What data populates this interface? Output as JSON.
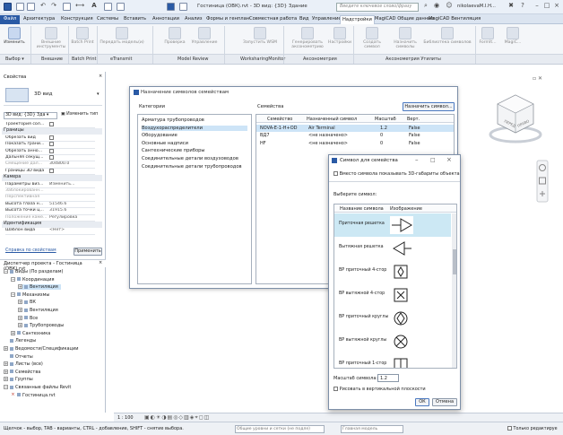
{
  "title_bar": {
    "title": "Гостиница (ОВК).rvt - 3D вид: {3D} Здание",
    "search_placeholder": "Введите ключевое слово/фразу",
    "user": "nikolaevaM.I.H...",
    "icons": [
      "revit-logo-icon",
      "open-icon",
      "save-icon",
      "undo-icon",
      "redo-icon",
      "print-icon",
      "measure-icon",
      "text-icon",
      "3d-view-icon",
      "section-icon",
      "thin-lines-icon",
      "switch-windows-icon",
      "search-icon",
      "signin-icon",
      "exchange-icon",
      "help-icon"
    ]
  },
  "ribbon": {
    "tabs": [
      "Файл",
      "Архитектура",
      "Конструкция",
      "Системы",
      "Вставить",
      "Аннотации",
      "Анализ",
      "Формы и генплан",
      "Совместная работа",
      "Вид",
      "Управление",
      "Надстройки",
      "MagiCAD Общие данные",
      "MagiCAD Вентиляция"
    ],
    "active_tab": "Надстройки",
    "buttons": [
      {
        "label": "Изменить",
        "enabled": true
      },
      {
        "label": "Внешние инструменты",
        "enabled": false
      },
      {
        "label": "Batch Print",
        "enabled": false
      },
      {
        "label": "Передать модель(и)",
        "enabled": false
      },
      {
        "label": "Проверка",
        "enabled": false
      },
      {
        "label": "Управление",
        "enabled": false
      },
      {
        "label": "Запустить WSM",
        "enabled": false
      },
      {
        "label": "Генерировать аксонометрию",
        "enabled": false
      },
      {
        "label": "Настройки",
        "enabled": false
      },
      {
        "label": "Создать символ",
        "enabled": false
      },
      {
        "label": "Назначить символы",
        "enabled": false
      },
      {
        "label": "Библиотека символов",
        "enabled": false
      },
      {
        "label": "FormIt...",
        "enabled": false
      },
      {
        "label": "MagiC...",
        "enabled": false
      }
    ],
    "panels": [
      "Выбор ▾",
      "Внешние",
      "Batch Print",
      "eTransmit",
      "Model Review",
      "WorksharingMonitor",
      "Аксонометрия",
      "Аксонометрия Утилиты"
    ]
  },
  "properties": {
    "title": "Свойства",
    "type_name": "3D вид",
    "selector": "3D вид: {3D} Зда ▾",
    "edit_type": "Изменить тип",
    "rows": [
      {
        "label": "Траектория сол...",
        "value": "",
        "checkbox": true
      },
      {
        "header": "Границы"
      },
      {
        "label": "Обрезать вид",
        "value": "",
        "checkbox": true
      },
      {
        "label": "Показать грани...",
        "value": "",
        "checkbox": true
      },
      {
        "label": "Обрезать анно...",
        "value": "",
        "checkbox": true
      },
      {
        "label": "Дальняя секущ...",
        "value": "",
        "checkbox": true
      },
      {
        "label": "Смещение дал...",
        "value": "304800.0",
        "grey": true
      },
      {
        "label": "Границы 3D вида",
        "value": "",
        "checkbox": true
      },
      {
        "header": "Камера"
      },
      {
        "label": "Параметры виз...",
        "value": "Изменить..."
      },
      {
        "label": "Заблокированн...",
        "value": "",
        "grey": true
      },
      {
        "label": "Перспективная",
        "value": "",
        "grey": true
      },
      {
        "label": "Высота глаза н...",
        "value": "51546.6"
      },
      {
        "label": "Высота точки ц...",
        "value": "31915.6"
      },
      {
        "label": "Положение каме...",
        "value": "Регулировка",
        "grey": true
      },
      {
        "header": "Идентификация"
      },
      {
        "label": "Шаблон вида",
        "value": "<Нет>"
      }
    ],
    "help_link": "Справка по свойствам",
    "apply": "Применить"
  },
  "browser": {
    "title": "Диспетчер проекта - Гостиница (ОВК).rvt",
    "items": [
      {
        "label": "Виды (По разделам)",
        "indent": 0,
        "box": "−"
      },
      {
        "label": "Координация",
        "indent": 1,
        "box": "−"
      },
      {
        "label": "Вентиляция",
        "indent": 2,
        "box": "+",
        "selected": true
      },
      {
        "label": "Механизмы",
        "indent": 1,
        "box": "−"
      },
      {
        "label": "ВК",
        "indent": 2,
        "box": "+"
      },
      {
        "label": "Вентиляция",
        "indent": 2,
        "box": "+"
      },
      {
        "label": "Все",
        "indent": 2,
        "box": "+"
      },
      {
        "label": "Трубопроводы",
        "indent": 2,
        "box": "+"
      },
      {
        "label": "Сантехника",
        "indent": 1,
        "box": "+"
      },
      {
        "label": "Легенды",
        "indent": 0,
        "box": ""
      },
      {
        "label": "Ведомости/Спецификации",
        "indent": 0,
        "box": "+"
      },
      {
        "label": "Отчеты",
        "indent": 0,
        "box": ""
      },
      {
        "label": "Листы (все)",
        "indent": 0,
        "box": "+"
      },
      {
        "label": "Семейства",
        "indent": 0,
        "box": "+"
      },
      {
        "label": "Группы",
        "indent": 0,
        "box": "+"
      },
      {
        "label": "Связанные файлы Revit",
        "indent": 0,
        "box": "−"
      },
      {
        "label": "Гостиница.rvt",
        "indent": 1,
        "box": "×"
      }
    ]
  },
  "assign_dialog": {
    "title": "Назначение символов семействам",
    "categories_label": "Категории",
    "families_label": "Семейства",
    "assign_button": "Назначить символ...",
    "categories": [
      "Арматура трубопроводов",
      "Воздухораспределители",
      "Оборудование",
      "Основные надписи",
      "Сантехнические приборы",
      "Соединительные детали воздуховодов",
      "Соединительные детали трубопроводов"
    ],
    "selected_category": 1,
    "columns": [
      "Семейство",
      "Назначенный символ",
      "Масштаб",
      "Верт."
    ],
    "rows": [
      {
        "family": "NOVA-E-1-H+OD",
        "symbol": "Air Terminal",
        "scale": "1.2",
        "vert": "False",
        "selected": true
      },
      {
        "family": "ВД7",
        "symbol": "<не назначено>",
        "scale": "0",
        "vert": "False"
      },
      {
        "family": "HF",
        "symbol": "<не назначено>",
        "scale": "0",
        "vert": "False"
      }
    ]
  },
  "symbol_dialog": {
    "title": "Символ для семейства",
    "show3d_label": "Вместо символа показывать 3D-габариты объекта",
    "choose_label": "Выберите символ:",
    "columns": [
      "Название символа",
      "Изображение"
    ],
    "symbols": [
      {
        "name": "Приточная решетка",
        "glyph": "supply-grille",
        "selected": true
      },
      {
        "name": "Вытяжная решетка",
        "glyph": "exhaust-grille"
      },
      {
        "name": "ВР приточный 4-стор",
        "glyph": "supply-4way"
      },
      {
        "name": "ВР вытяжной 4-стор",
        "glyph": "exhaust-4way"
      },
      {
        "name": "ВР приточный круглы",
        "glyph": "supply-round"
      },
      {
        "name": "ВР вытяжной круглы",
        "glyph": "exhaust-round"
      },
      {
        "name": "ВР приточный 1-стор",
        "glyph": "supply-1way"
      }
    ],
    "scale_label": "Масштаб символа:",
    "scale_value": "1.2",
    "vertical_label": "Рисовать в вертикальной плоскости",
    "ok": "ОК",
    "cancel": "Отмена"
  },
  "view_control": {
    "scale": "1 : 100"
  },
  "status": {
    "hint": "Щелчок - выбор, TAB - варианты, CTRL - добавление, SHIFT - снятие выбора.",
    "level_placeholder": "Общие уровни и сетки (не подле)",
    "model": "Главная модель",
    "editable_only": "Только редактируе"
  },
  "colors": {
    "accent": "#2a5aa5",
    "selection": "#cce8f4",
    "ribbon": "#f4f6f9"
  }
}
